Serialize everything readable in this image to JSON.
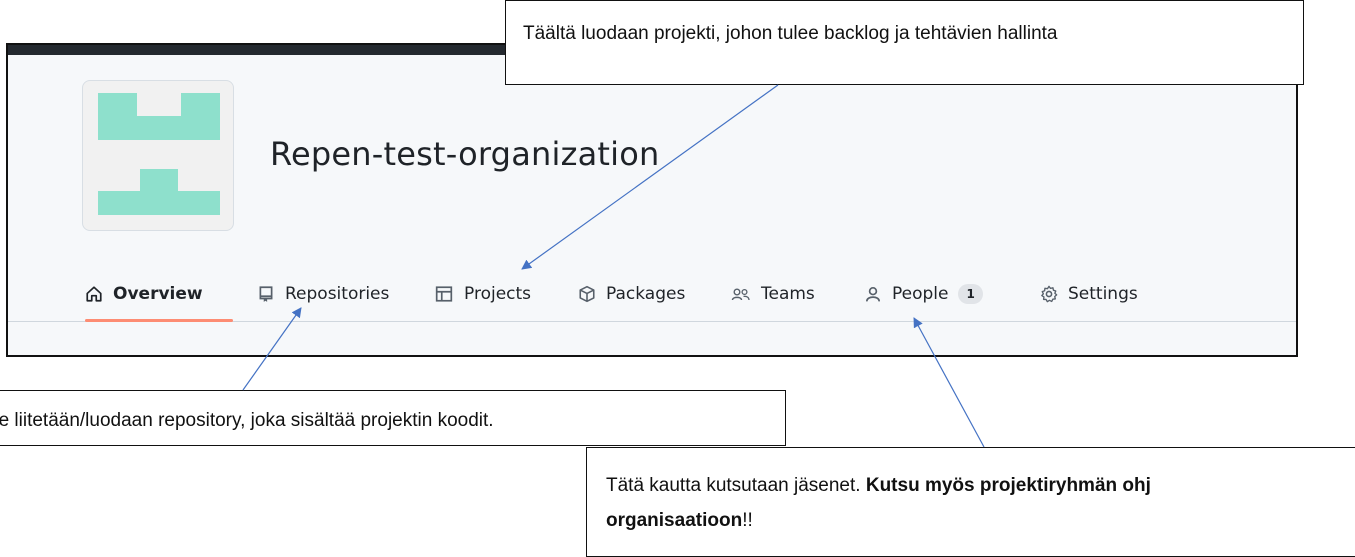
{
  "org": {
    "name": "Repen-test-organization",
    "avatar_color": "#8ee0cc"
  },
  "tabs": [
    {
      "label": "Overview",
      "icon": "home-icon",
      "active": true
    },
    {
      "label": "Repositories",
      "icon": "repo-icon"
    },
    {
      "label": "Projects",
      "icon": "table-icon"
    },
    {
      "label": "Packages",
      "icon": "package-icon"
    },
    {
      "label": "Teams",
      "icon": "people-icon"
    },
    {
      "label": "People",
      "icon": "person-icon",
      "count": "1"
    },
    {
      "label": "Settings",
      "icon": "gear-icon"
    }
  ],
  "callouts": {
    "projects": "Täältä luodaan projekti, johon tulee backlog ja tehtävien hallinta",
    "repos": "ne liitetään/luodaan repository, joka sisältää projektin koodit.",
    "people_prefix": "Tätä kautta kutsutaan jäsenet. ",
    "people_bold1": "Kutsu myös projektiryhmän ohj",
    "people_bold2": "organisaatioon",
    "people_suffix": "!!"
  },
  "colors": {
    "accent_underline": "#fd8c73",
    "arrow": "#4472c4",
    "topbar": "#24292f"
  }
}
